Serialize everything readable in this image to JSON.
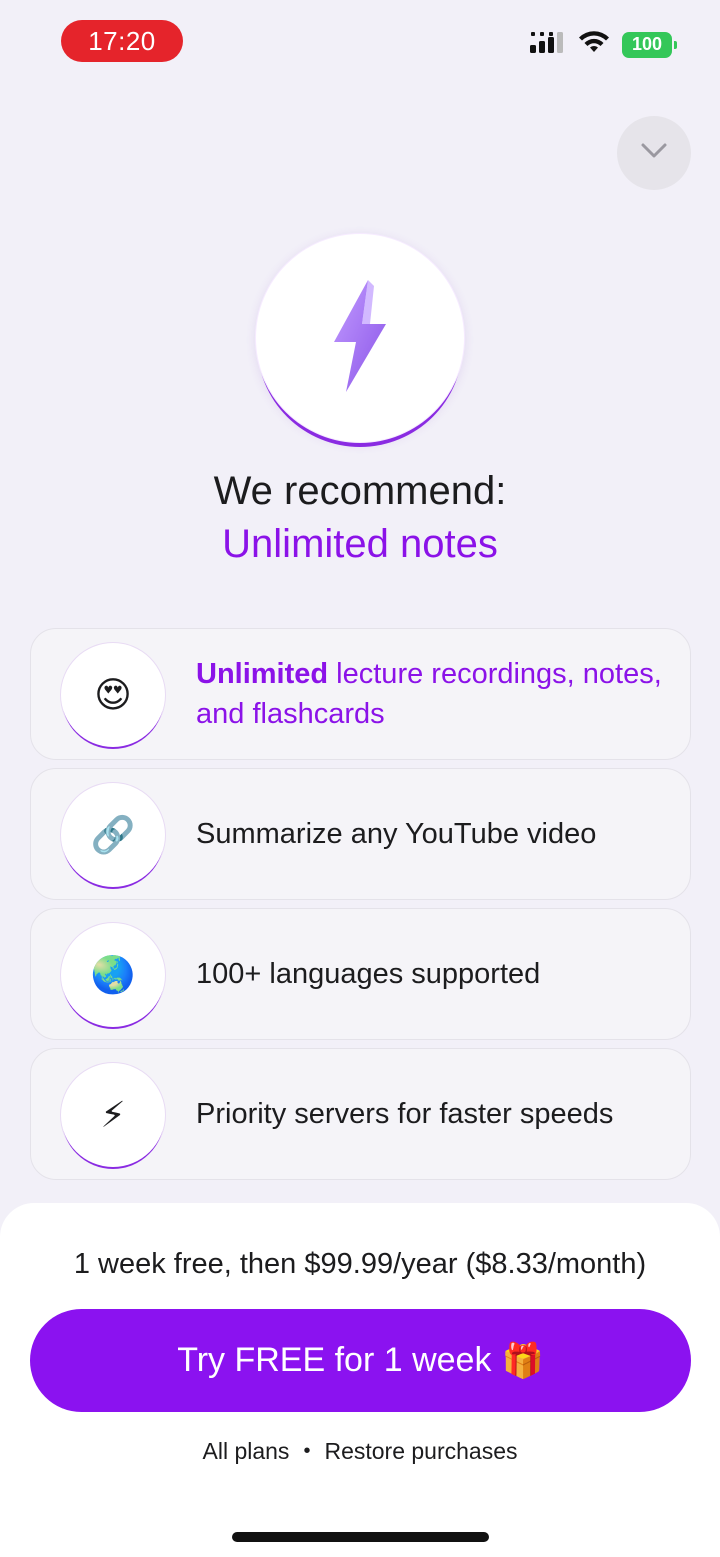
{
  "status_bar": {
    "time": "17:20",
    "battery": "100",
    "icons": [
      "signal-icon",
      "wifi-icon",
      "battery-icon"
    ],
    "time_pill_color": "#e5242b",
    "battery_color": "#34c759"
  },
  "header": {
    "collapse_icon": "chevron-down-icon",
    "hero_icon": "lightning-bolt-icon"
  },
  "headline": "We recommend:",
  "subheadline": "Unlimited notes",
  "features": [
    {
      "icon": "heart-eyes-emoji",
      "glyph": "😍",
      "highlight": "Unlimited",
      "text": " lecture recordings, notes, and flashcards"
    },
    {
      "icon": "link-icon",
      "glyph": "🔗",
      "text": "Summarize any YouTube video"
    },
    {
      "icon": "globe-icon",
      "glyph": "🌏",
      "text": "100+ languages supported"
    },
    {
      "icon": "lightning-icon",
      "glyph": "⚡",
      "text": "Priority servers for faster speeds"
    }
  ],
  "pricing": {
    "line": "1 week free, then $99.99/year ($8.33/month)",
    "cta_label": "Try FREE for 1 week",
    "cta_icon": "gift-icon",
    "cta_glyph": "🎁"
  },
  "links": {
    "all_plans": "All plans",
    "separator": "•",
    "restore": "Restore purchases"
  },
  "colors": {
    "accent": "#8b12f0",
    "background": "#f2f0f8"
  }
}
